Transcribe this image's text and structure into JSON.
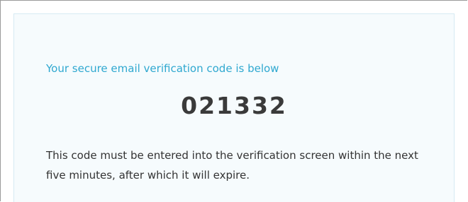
{
  "email": {
    "heading": "Your secure email verification code is below",
    "code": "021332",
    "message": "This code must be entered into the verification screen within the next five minutes, after which it will expire."
  },
  "colors": {
    "heading": "#2fa8d0",
    "code": "#3a3a3a",
    "text": "#333333",
    "card_background": "#f6fbfd"
  }
}
